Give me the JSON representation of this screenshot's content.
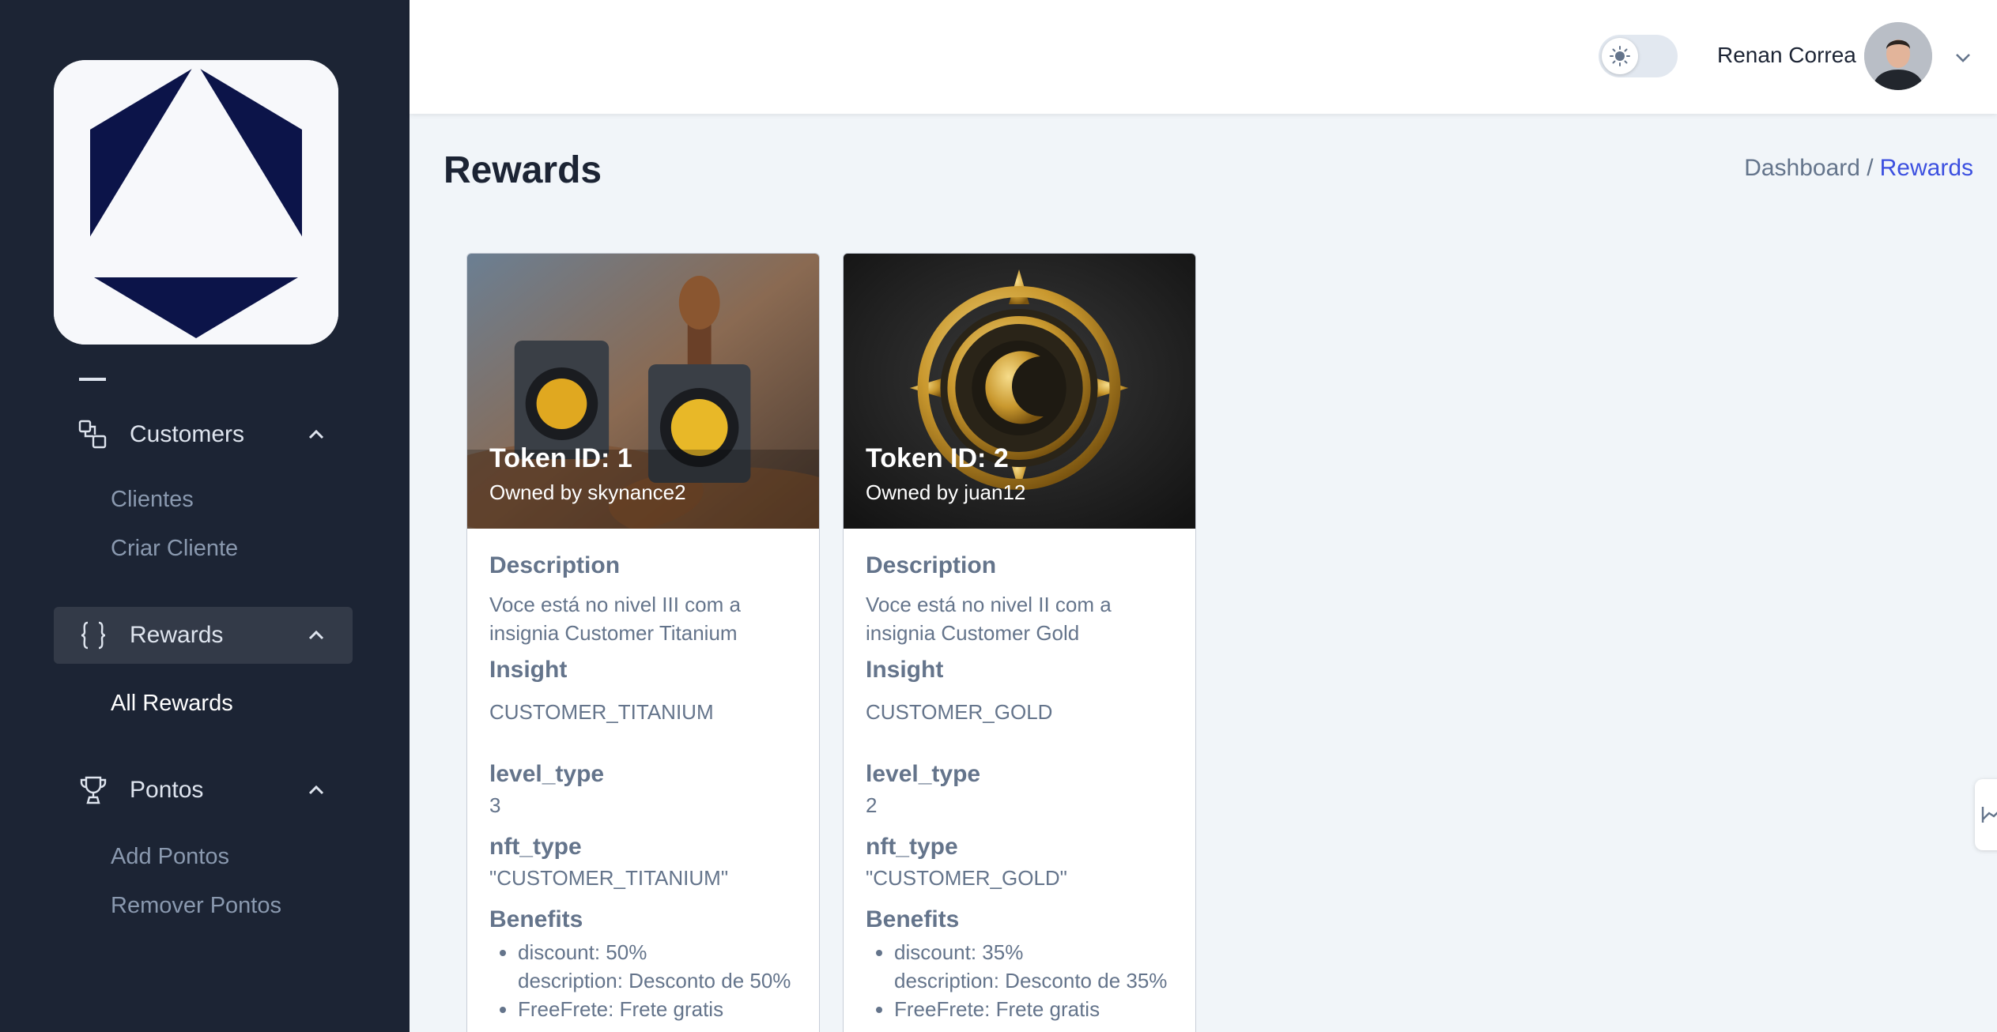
{
  "sidebar": {
    "groups": [
      {
        "label": "Customers",
        "icon": "group-icon",
        "subitems": [
          "Clientes",
          "Criar Cliente"
        ]
      },
      {
        "label": "Rewards",
        "icon": "braces-icon",
        "subitems": [
          "All Rewards"
        ]
      },
      {
        "label": "Pontos",
        "icon": "trophy-icon",
        "subitems": [
          "Add Pontos",
          "Remover Pontos"
        ]
      }
    ]
  },
  "header": {
    "user_name": "Renan Correa"
  },
  "page": {
    "title": "Rewards",
    "breadcrumb": {
      "home": "Dashboard /",
      "current": "Rewards"
    }
  },
  "cards": [
    {
      "token": "Token ID: 1",
      "owner": "Owned by skynance2",
      "description_label": "Description",
      "description": "Voce está no nivel III com a insignia Customer Titanium",
      "insight_label": "Insight",
      "insight": "CUSTOMER_TITANIUM",
      "level_label": "level_type",
      "level": "3",
      "nft_label": "nft_type",
      "nft": "\"CUSTOMER_TITANIUM\"",
      "benefits_label": "Benefits",
      "benefits": [
        "discount: 50%",
        "description: Desconto de 50%",
        "FreeFrete: Frete gratis"
      ]
    },
    {
      "token": "Token ID: 2",
      "owner": "Owned by juan12",
      "description_label": "Description",
      "description": "Voce está no nivel II com a insignia Customer Gold",
      "insight_label": "Insight",
      "insight": "CUSTOMER_GOLD",
      "level_label": "level_type",
      "level": "2",
      "nft_label": "nft_type",
      "nft": "\"CUSTOMER_GOLD\"",
      "benefits_label": "Benefits",
      "benefits": [
        "discount: 35%",
        "description: Desconto de 35%",
        "FreeFrete: Frete gratis"
      ]
    }
  ],
  "colors": {
    "sidebar_bg": "#1c2434",
    "accent": "#3c50e0",
    "logo_navy": "#0c1449"
  }
}
